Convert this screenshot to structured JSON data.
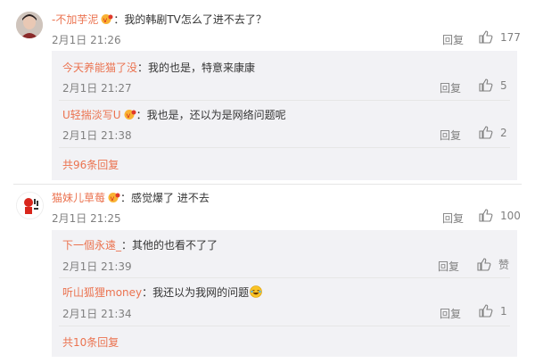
{
  "comments": [
    {
      "username": "-不加芋泥",
      "text": "：我的韩剧TV怎么了进不去了？",
      "time": "2月1日 21:26",
      "reply_label": "回复",
      "likes": "177",
      "replies": [
        {
          "username": "今天养能猫了没",
          "text": "：我的也是，特意来康康",
          "time": "2月1日 21:27",
          "reply_label": "回复",
          "likes": "5"
        },
        {
          "username": "U轻揣淡写U",
          "text": "：我也是，还以为是网络问题呢",
          "time": "2月1日 21:38",
          "reply_label": "回复",
          "likes": "2"
        }
      ],
      "more_replies": "共96条回复"
    },
    {
      "username": "猫妹儿草莓",
      "text": "：感觉爆了 进不去",
      "time": "2月1日 21:25",
      "reply_label": "回复",
      "likes": "100",
      "replies": [
        {
          "username": "下一個永遠_",
          "text": "：其他的也看不了了",
          "time": "2月1日 21:39",
          "reply_label": "回复",
          "likes": "赞"
        },
        {
          "username": "听山狐狸money",
          "text": "：我还以为我网的问题",
          "time": "2月1日 21:34",
          "reply_label": "回复",
          "likes": "1"
        }
      ],
      "more_replies": "共10条回复"
    }
  ],
  "colors": {
    "username": "#eb7350",
    "text": "#333333",
    "meta": "#808080",
    "reply_bg": "#f2f2f5"
  },
  "icons": {
    "like": "thumbs-up-icon",
    "vip": "vip-badge-icon",
    "emoji": "laughing-emoji-icon"
  }
}
